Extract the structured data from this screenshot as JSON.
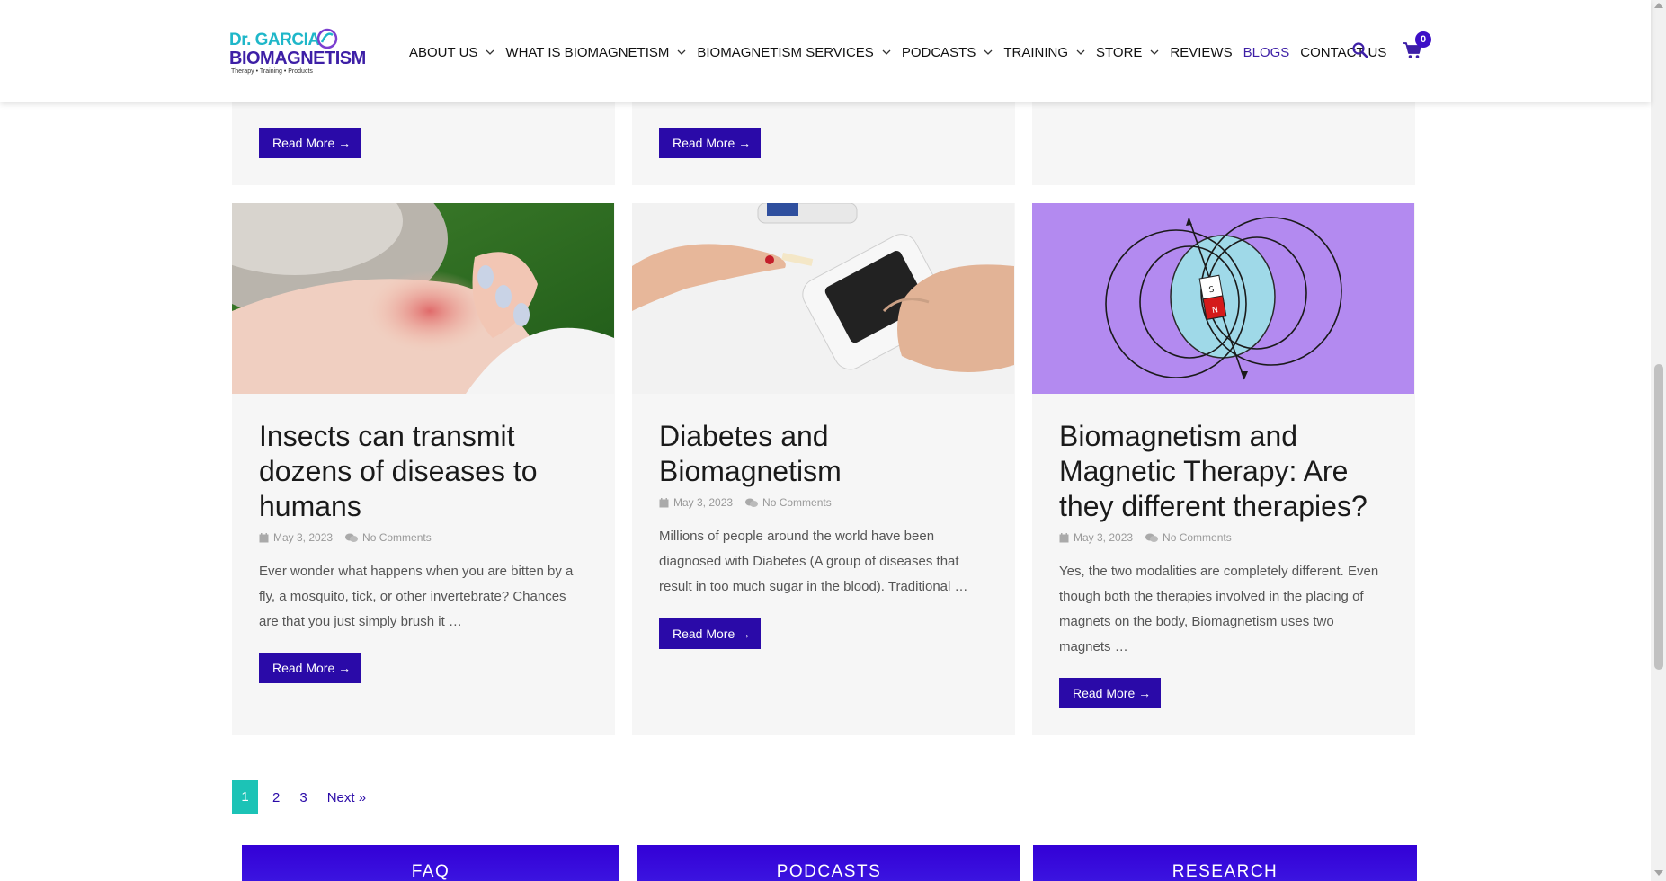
{
  "header": {
    "logo": {
      "line1": "Dr. GARCIA",
      "line2": "BIOMAGNETISM",
      "tagline": "Therapy • Training • Products"
    },
    "nav": [
      {
        "label": "ABOUT US",
        "dropdown": true
      },
      {
        "label": "WHAT IS BIOMAGNETISM",
        "dropdown": true
      },
      {
        "label": "BIOMAGNETISM SERVICES",
        "dropdown": true
      },
      {
        "label": "PODCASTS",
        "dropdown": true
      },
      {
        "label": "TRAINING",
        "dropdown": true
      },
      {
        "label": "STORE",
        "dropdown": true
      },
      {
        "label": "REVIEWS",
        "dropdown": false
      },
      {
        "label": "BLOGS",
        "dropdown": false,
        "active": true
      },
      {
        "label": "CONTACT US",
        "dropdown": false
      }
    ],
    "cart_count": "0",
    "icons": {
      "search": "search-icon",
      "cart": "cart-icon"
    }
  },
  "top_row": {
    "read_more": [
      "Read More →",
      "Read More →"
    ]
  },
  "posts": [
    {
      "title": "Insects can transmit dozens of diseases to humans",
      "date": "May 3, 2023",
      "comments": "No Comments",
      "excerpt": "Ever wonder what happens when you are bitten by a fly, a mosquito, tick, or other invertebrate? Chances are that you just simply brush it …",
      "read_more": "Read More →"
    },
    {
      "title": "Diabetes and Biomagnetism",
      "date": "May 3, 2023",
      "comments": "No Comments",
      "excerpt": "Millions of people around the world have been diagnosed with Diabetes (A group of diseases that result in too much sugar in the blood). Traditional …",
      "read_more": "Read More →"
    },
    {
      "title": "Biomagnetism and Magnetic Therapy: Are they different therapies?",
      "date": "May 3, 2023",
      "comments": "No Comments",
      "excerpt": "Yes, the two modalities are completely different. Even though both the therapies involved in the placing of magnets on the body, Biomagnetism uses two magnets …",
      "read_more": "Read More →"
    }
  ],
  "pagination": {
    "current": "1",
    "pages": [
      "2",
      "3"
    ],
    "next": "Next »"
  },
  "footer_tiles": [
    "FAQ",
    "PODCASTS",
    "RESEARCH"
  ],
  "colors": {
    "brand": "#2a0aa8",
    "accent_teal": "#1cc3b6",
    "card_bg": "#f6f6f6",
    "magnet_bg": "#b38af0"
  }
}
